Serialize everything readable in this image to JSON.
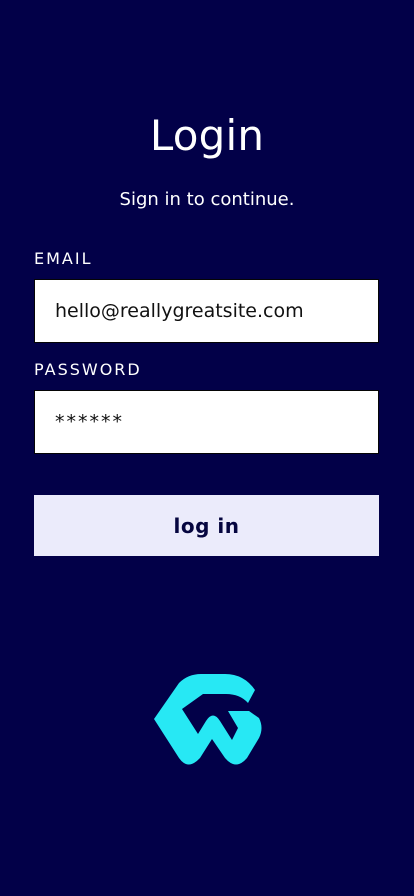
{
  "colors": {
    "background": "#020048",
    "text": "#ffffff",
    "field_background": "#ffffff",
    "button_background": "#ebebfb",
    "button_text": "#05053f",
    "logo": "#27e8f4"
  },
  "header": {
    "title": "Login",
    "subtitle": "Sign in to continue."
  },
  "form": {
    "email_label": "EMAIL",
    "email_value": "hello@reallygreatsite.com",
    "password_label": "PASSWORD",
    "password_value": "******",
    "submit_label": "log in"
  },
  "brand": {
    "logo_icon": "wg-logo-icon"
  }
}
